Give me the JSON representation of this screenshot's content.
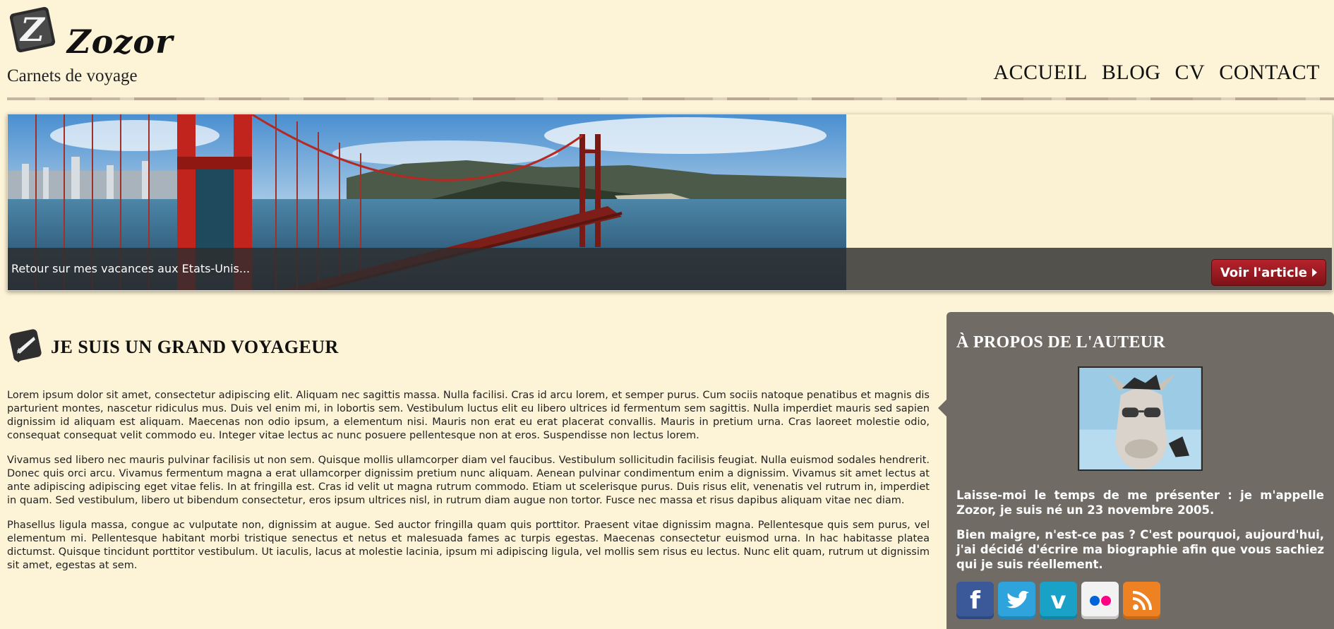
{
  "site": {
    "title": "Zozor",
    "tagline": "Carnets de voyage"
  },
  "nav": {
    "items": [
      {
        "label": "ACCUEIL"
      },
      {
        "label": "BLOG"
      },
      {
        "label": "CV"
      },
      {
        "label": "CONTACT"
      }
    ]
  },
  "banner": {
    "caption": "Retour sur mes vacances aux Etats-Unis...",
    "button_label": "Voir l'article"
  },
  "article": {
    "title": "JE SUIS UN GRAND VOYAGEUR",
    "paragraphs": [
      "Lorem ipsum dolor sit amet, consectetur adipiscing elit. Aliquam nec sagittis massa. Nulla facilisi. Cras id arcu lorem, et semper purus. Cum sociis natoque penatibus et magnis dis parturient montes, nascetur ridiculus mus. Duis vel enim mi, in lobortis sem. Vestibulum luctus elit eu libero ultrices id fermentum sem sagittis. Nulla imperdiet mauris sed sapien dignissim id aliquam est aliquam. Maecenas non odio ipsum, a elementum nisi. Mauris non erat eu erat placerat convallis. Mauris in pretium urna. Cras laoreet molestie odio, consequat consequat velit commodo eu. Integer vitae lectus ac nunc posuere pellentesque non at eros. Suspendisse non lectus lorem.",
      "Vivamus sed libero nec mauris pulvinar facilisis ut non sem. Quisque mollis ullamcorper diam vel faucibus. Vestibulum sollicitudin facilisis feugiat. Nulla euismod sodales hendrerit. Donec quis orci arcu. Vivamus fermentum magna a erat ullamcorper dignissim pretium nunc aliquam. Aenean pulvinar condimentum enim a dignissim. Vivamus sit amet lectus at ante adipiscing adipiscing eget vitae felis. In at fringilla est. Cras id velit ut magna rutrum commodo. Etiam ut scelerisque purus. Duis risus elit, venenatis vel rutrum in, imperdiet in quam. Sed vestibulum, libero ut bibendum consectetur, eros ipsum ultrices nisl, in rutrum diam augue non tortor. Fusce nec massa et risus dapibus aliquam vitae nec diam.",
      "Phasellus ligula massa, congue ac vulputate non, dignissim at augue. Sed auctor fringilla quam quis porttitor. Praesent vitae dignissim magna. Pellentesque quis sem purus, vel elementum mi. Pellentesque habitant morbi tristique senectus et netus et malesuada fames ac turpis egestas. Maecenas consectetur euismod urna. In hac habitasse platea dictumst. Quisque tincidunt porttitor vestibulum. Ut iaculis, lacus at molestie lacinia, ipsum mi adipiscing ligula, vel mollis sem risus eu lectus. Nunc elit quam, rutrum ut dignissim sit amet, egestas at sem."
    ]
  },
  "sidebar": {
    "title": "À PROPOS DE L'AUTEUR",
    "paragraphs": [
      "Laisse-moi le temps de me présenter : je m'appelle Zozor, je suis né un 23 novembre 2005.",
      "Bien maigre, n'est-ce pas ? C'est pourquoi, aujourd'hui, j'ai décidé d'écrire ma biographie afin que vous sachiez qui je suis réellement."
    ],
    "socials": [
      {
        "icon": "facebook-icon",
        "color": "#3b5998"
      },
      {
        "icon": "twitter-icon",
        "color": "#2fa3dc"
      },
      {
        "icon": "vimeo-icon",
        "color": "#1aa1c7"
      },
      {
        "icon": "flickr-icon",
        "color": "#f2f2f2"
      },
      {
        "icon": "rss-icon",
        "color": "#ee8122"
      }
    ]
  },
  "colors": {
    "page_bg": "#fdf3d6",
    "sidebar_bg": "#706b64",
    "button_red": "#b7232c"
  }
}
